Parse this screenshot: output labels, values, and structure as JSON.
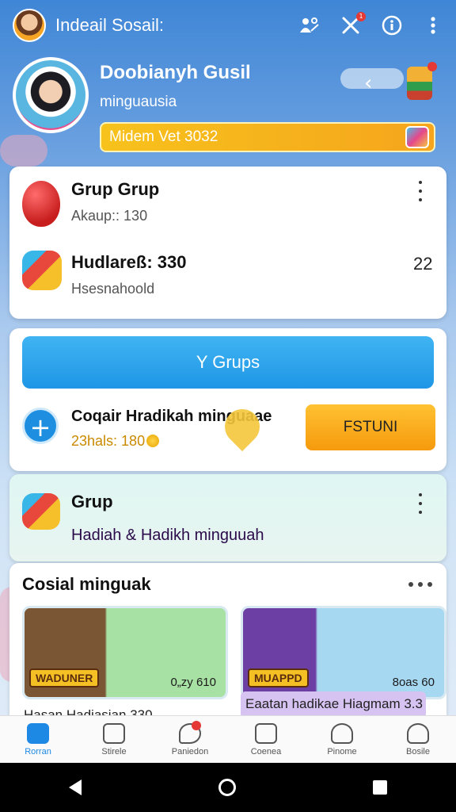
{
  "app": {
    "title": "Indeail Sosail:"
  },
  "profile": {
    "name": "Doobianyh Gusil",
    "subtitle": "minguausia",
    "level_text": "Midem Vet 3032"
  },
  "card1": {
    "row1": {
      "title": "Grup Grup",
      "sub": "Akaup:: 130"
    },
    "row2": {
      "title": "Hudlareß: 330",
      "sub": "Hsesnahoold",
      "right_value": "22"
    }
  },
  "card2": {
    "button_label": "Υ Grups",
    "invite_title": "Coqair Hradikah minguaae",
    "invite_sub": "23hals: 180",
    "action_label": "FSTUNI"
  },
  "card3": {
    "title": "Grup",
    "sub": "Hadiah & Hadikh minguuah"
  },
  "card4": {
    "title": "Cosial minguak",
    "thumbs": [
      {
        "badge": "WADUNER",
        "count": "0„zy 610",
        "caption": "Hasan Hadiasian 330"
      },
      {
        "badge": "MUAPPD",
        "count": "8оas 60",
        "caption": "Eaatan hadikae Hiagmam 3.3"
      }
    ]
  },
  "bottom_nav": [
    {
      "label": "Rorran",
      "icon": "home-icon",
      "active": true
    },
    {
      "label": "Stirele",
      "icon": "store-icon",
      "active": false
    },
    {
      "label": "Paniedon",
      "icon": "chat-icon",
      "active": false
    },
    {
      "label": "Coenea",
      "icon": "mail-icon",
      "active": false
    },
    {
      "label": "Pinome",
      "icon": "person-icon",
      "active": false
    },
    {
      "label": "Bosile",
      "icon": "profile-icon",
      "active": false
    }
  ],
  "notifications": {
    "badge": "1"
  },
  "colors": {
    "accent": "#1e88e5",
    "level": "#f7c21c",
    "action": "#f5a00e"
  }
}
